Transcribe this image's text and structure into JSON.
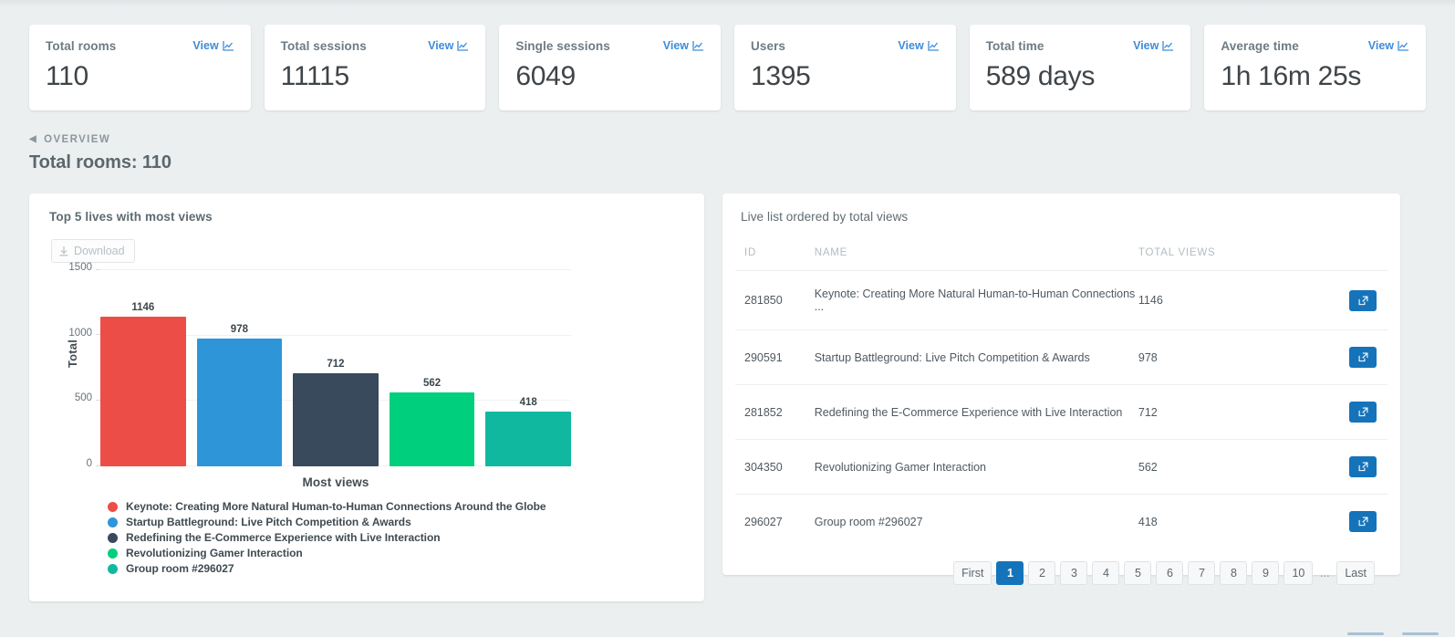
{
  "stats": {
    "view_label": "View",
    "cards": [
      {
        "label": "Total rooms",
        "value": "110"
      },
      {
        "label": "Total sessions",
        "value": "11115"
      },
      {
        "label": "Single sessions",
        "value": "6049"
      },
      {
        "label": "Users",
        "value": "1395"
      },
      {
        "label": "Total time",
        "value": "589 days"
      },
      {
        "label": "Average time",
        "value": "1h 16m 25s"
      }
    ]
  },
  "breadcrumb": {
    "label": "OVERVIEW",
    "arrow": "◀"
  },
  "page_title": "Total rooms: 110",
  "left_panel": {
    "title": "Top 5 lives with most views",
    "download_label": "Download",
    "download_icon": "download-arrow-icon"
  },
  "right_panel": {
    "title": "Live list ordered by total views",
    "columns": [
      "ID",
      "NAME",
      "TOTAL VIEWS",
      ""
    ],
    "rows": [
      {
        "id": "281850",
        "name": "Keynote: Creating More Natural Human-to-Human Connections ...",
        "views": "1146",
        "action_icon": "external-link-icon"
      },
      {
        "id": "290591",
        "name": "Startup Battleground: Live Pitch Competition & Awards",
        "views": "978",
        "action_icon": "external-link-icon"
      },
      {
        "id": "281852",
        "name": "Redefining the E-Commerce Experience with Live Interaction",
        "views": "712",
        "action_icon": "external-link-icon"
      },
      {
        "id": "304350",
        "name": "Revolutionizing Gamer Interaction",
        "views": "562",
        "action_icon": "external-link-icon"
      },
      {
        "id": "296027",
        "name": "Group room #296027",
        "views": "418",
        "action_icon": "external-link-icon"
      }
    ],
    "pagination": {
      "first": "First",
      "pages": [
        "1",
        "2",
        "3",
        "4",
        "5",
        "6",
        "7",
        "8",
        "9",
        "10"
      ],
      "ellipsis": "...",
      "last": "Last",
      "active": "1"
    }
  },
  "chart_data": {
    "type": "bar",
    "title": "Top 5 lives with most views",
    "xlabel": "Most views",
    "ylabel": "Total",
    "ylim": [
      0,
      1500
    ],
    "yticks": [
      0,
      500,
      1000,
      1500
    ],
    "grid": true,
    "legend_position": "bottom-left",
    "categories": [
      "Keynote: Creating More Natural Human-to-Human Connections Around the Globe",
      "Startup Battleground: Live Pitch Competition & Awards",
      "Redefining the E-Commerce Experience with Live Interaction",
      "Revolutionizing Gamer Interaction",
      "Group room #296027"
    ],
    "values": [
      1146,
      978,
      712,
      562,
      418
    ],
    "colors": [
      "#ec4e47",
      "#2e96d8",
      "#384a5c",
      "#00cf7d",
      "#11b8a0"
    ],
    "data_labels": [
      "1146",
      "978",
      "712",
      "562",
      "418"
    ]
  },
  "colors": {
    "accent": "#1573ba",
    "link": "#3d8ddb",
    "page_bg": "#eceff0",
    "card_bg": "#ffffff"
  }
}
